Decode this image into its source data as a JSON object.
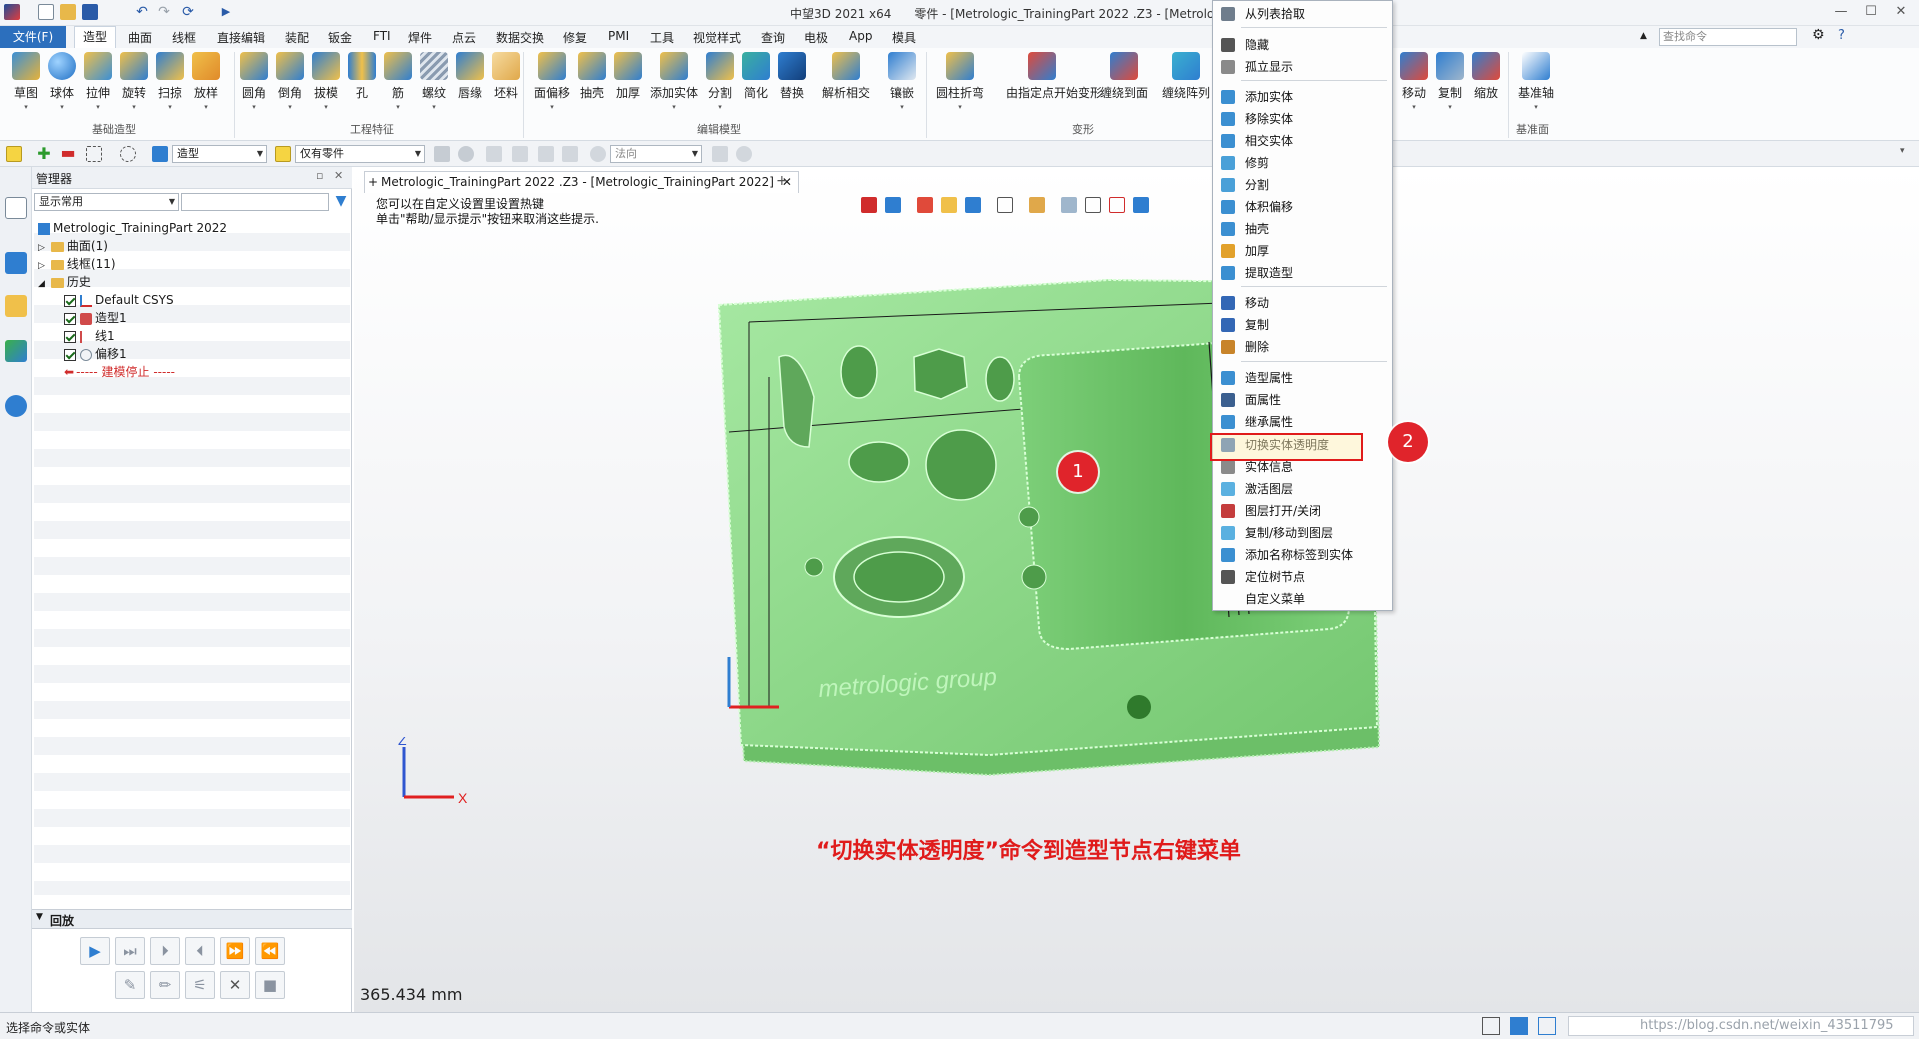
{
  "app": {
    "title": "中望3D 2021 x64",
    "doc_title": "零件 - [Metrologic_TrainingPart  2022 .Z3 - [Metrologic_Trai"
  },
  "menu": {
    "file": "文件(F)",
    "tabs": [
      "造型",
      "曲面",
      "线框",
      "直接编辑",
      "装配",
      "钣金",
      "FTI",
      "焊件",
      "点云",
      "数据交换",
      "修复",
      "PMI",
      "工具",
      "视觉样式",
      "查询",
      "电极",
      "App",
      "模具"
    ],
    "search_placeholder": "查找命令"
  },
  "ribbon": {
    "basic": {
      "label": "基础造型",
      "items": [
        "草图",
        "球体",
        "拉伸",
        "旋转",
        "扫掠",
        "放样"
      ]
    },
    "engineering": {
      "label": "工程特征",
      "items": [
        "圆角",
        "倒角",
        "拔模",
        "孔",
        "筋",
        "螺纹",
        "唇缘",
        "坯料"
      ]
    },
    "edit": {
      "label": "编辑模型",
      "items": [
        "面偏移",
        "抽壳",
        "加厚",
        "添加实体",
        "分割",
        "简化",
        "替换",
        "解析相交",
        "镶嵌"
      ]
    },
    "deform": {
      "label": "变形",
      "items": [
        "圆柱折弯",
        "由指定点开始变形",
        "缠绕到面",
        "缠绕阵列"
      ]
    },
    "basic_edit": {
      "items": [
        "移动",
        "复制",
        "缩放"
      ]
    },
    "datum": {
      "label": "基准面",
      "items": [
        "基准轴"
      ]
    }
  },
  "toolbar2": {
    "filter_value": "造型",
    "scope_value": "仅有零件",
    "direction_value": "法向"
  },
  "manager": {
    "title": "管理器",
    "filter_value": "显示常用",
    "root": "Metrologic_TrainingPart  2022",
    "nodes": {
      "surface": "曲面(1)",
      "wireframe": "线框(11)",
      "history": "历史",
      "csys": "Default CSYS",
      "shape1": "造型1",
      "line1": "线1",
      "offset1": "偏移1",
      "stop": "----- 建模停止 -----"
    },
    "playback_title": "回放"
  },
  "viewport": {
    "doc_tab": "Metrologic_TrainingPart  2022 .Z3 - [Metrologic_TrainingPart  2022]",
    "hint_line1": "您可以在自定义设置里设置热键",
    "hint_line2": "单击\"帮助/显示提示\"按钮来取消这些提示.",
    "caption": "“切换实体透明度”命令到造型节点右键菜单",
    "distance": "365.434 mm",
    "model_text": "metrologic group"
  },
  "context_menu": {
    "items": [
      {
        "label": "从列表拾取",
        "icon": "cursor-icon",
        "color": "#6f7d8c"
      },
      {
        "label": "隐藏",
        "icon": "hide-icon",
        "color": "#555555"
      },
      {
        "label": "孤立显示",
        "icon": "isolate-icon",
        "color": "#8a8a8a"
      },
      {
        "label": "添加实体",
        "icon": "add-body-icon",
        "color": "#3b8fd1"
      },
      {
        "label": "移除实体",
        "icon": "remove-body-icon",
        "color": "#3b8fd1"
      },
      {
        "label": "相交实体",
        "icon": "intersect-body-icon",
        "color": "#3b8fd1"
      },
      {
        "label": "修剪",
        "icon": "trim-icon",
        "color": "#4aa0d8"
      },
      {
        "label": "分割",
        "icon": "split-icon",
        "color": "#4aa0d8"
      },
      {
        "label": "体积偏移",
        "icon": "volume-offset-icon",
        "color": "#3b8fd1"
      },
      {
        "label": "抽壳",
        "icon": "shell-icon",
        "color": "#3b8fd1"
      },
      {
        "label": "加厚",
        "icon": "thicken-icon",
        "color": "#e2a12b"
      },
      {
        "label": "提取造型",
        "icon": "extract-shape-icon",
        "color": "#3b8fd1"
      },
      {
        "label": "移动",
        "icon": "move-icon",
        "color": "#3367b5"
      },
      {
        "label": "复制",
        "icon": "copy-icon",
        "color": "#3367b5"
      },
      {
        "label": "删除",
        "icon": "delete-icon",
        "color": "#c8842a"
      },
      {
        "label": "造型属性",
        "icon": "shape-attr-icon",
        "color": "#3b8fd1"
      },
      {
        "label": "面属性",
        "icon": "face-attr-icon",
        "color": "#3b5f8f"
      },
      {
        "label": "继承属性",
        "icon": "inherit-attr-icon",
        "color": "#3b8fd1"
      },
      {
        "label": "切换实体透明度",
        "icon": "toggle-transparency-icon",
        "color": "#3367b5"
      },
      {
        "label": "实体信息",
        "icon": "body-info-icon",
        "color": "#8a8a8a"
      },
      {
        "label": "激活图层",
        "icon": "activate-layer-icon",
        "color": "#5ab0e0"
      },
      {
        "label": "图层打开/关闭",
        "icon": "layer-toggle-icon",
        "color": "#c43c3c"
      },
      {
        "label": "复制/移动到图层",
        "icon": "copy-move-layer-icon",
        "color": "#5ab0e0"
      },
      {
        "label": "添加名称标签到实体",
        "icon": "add-name-tag-icon",
        "color": "#3b8fd1"
      },
      {
        "label": "定位树节点",
        "icon": "locate-node-icon",
        "color": "#555555"
      },
      {
        "label": "自定义菜单",
        "icon": "",
        "color": ""
      }
    ]
  },
  "annotations": {
    "marker1": "1",
    "marker2": "2",
    "highlight_color": "#e01b1b"
  },
  "status": {
    "text": "选择命令或实体",
    "watermark": "https://blog.csdn.net/weixin_43511795"
  },
  "colors": {
    "accent": "#2c6fbd",
    "model_green": "#8ed88b",
    "annotation_red": "#e01b1b"
  }
}
